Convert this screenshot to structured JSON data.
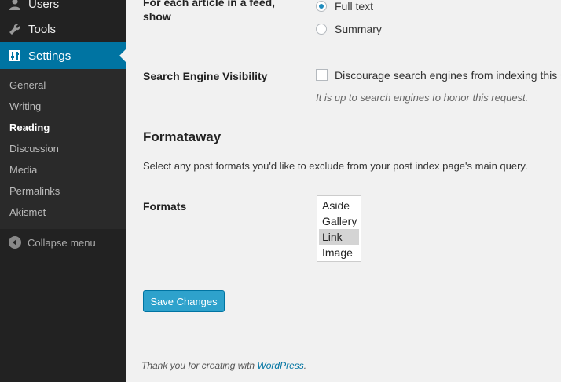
{
  "sidebar": {
    "items": [
      {
        "label": "Users",
        "icon": "users-icon"
      },
      {
        "label": "Tools",
        "icon": "wrench-icon"
      },
      {
        "label": "Settings",
        "icon": "settings-icon"
      }
    ],
    "submenu": [
      "General",
      "Writing",
      "Reading",
      "Discussion",
      "Media",
      "Permalinks",
      "Akismet"
    ],
    "current_submenu": "Reading",
    "collapse_label": "Collapse menu"
  },
  "feed": {
    "label": "For each article in a feed, show",
    "options": [
      {
        "label": "Full text",
        "checked": true
      },
      {
        "label": "Summary",
        "checked": false
      }
    ]
  },
  "visibility": {
    "label": "Search Engine Visibility",
    "checkbox_label": "Discourage search engines from indexing this site",
    "checked": false,
    "description": "It is up to search engines to honor this request."
  },
  "formataway": {
    "heading": "Formataway",
    "description": "Select any post formats you'd like to exclude from your post index page's main query.",
    "formats_label": "Formats",
    "formats": [
      "Aside",
      "Gallery",
      "Link",
      "Image"
    ],
    "selected": "Link"
  },
  "save_label": "Save Changes",
  "footer": {
    "text": "Thank you for creating with ",
    "link": "WordPress",
    "suffix": "."
  },
  "colors": {
    "sidebar_bg": "#222222",
    "active_menu": "#0074a2",
    "button": "#2ea2cc",
    "link": "#0074a2"
  }
}
